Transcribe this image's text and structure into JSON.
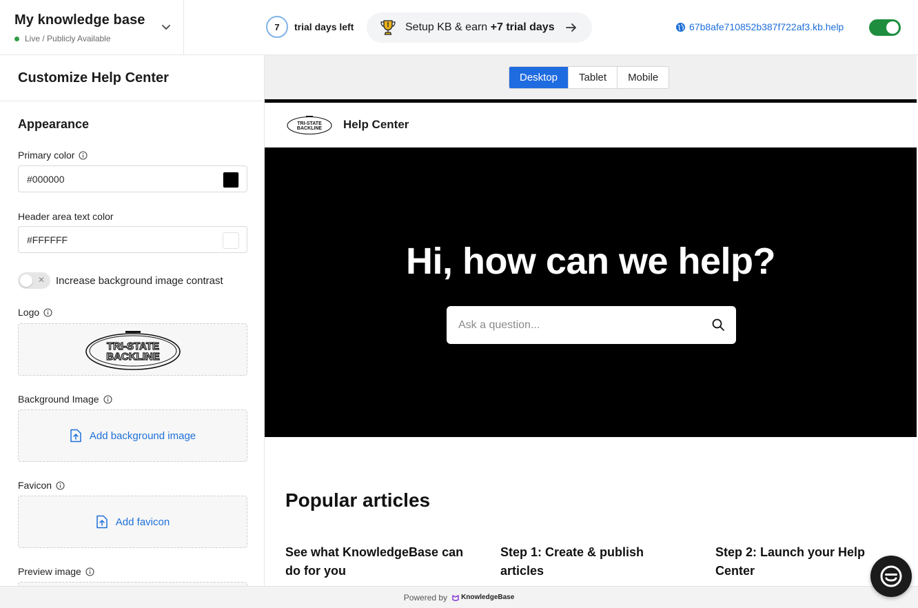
{
  "topbar": {
    "kb_name": "My knowledge base",
    "kb_status": "Live / Publicly Available",
    "trial_days": "7",
    "trial_text": "trial days left",
    "setup_text": "Setup KB & earn ",
    "setup_bonus": "+7 trial days",
    "kb_url": "67b8afe710852b387f722af3.kb.help"
  },
  "left": {
    "title": "Customize Help Center",
    "section": "Appearance",
    "primary_color_label": "Primary color",
    "primary_color_value": "#000000",
    "header_text_color_label": "Header area text color",
    "header_text_color_value": "#FFFFFF",
    "contrast_label": "Increase background image contrast",
    "logo_label": "Logo",
    "bg_image_label": "Background Image",
    "bg_image_add": "Add background image",
    "favicon_label": "Favicon",
    "favicon_add": "Add favicon",
    "preview_image_label": "Preview image"
  },
  "device_tabs": [
    "Desktop",
    "Tablet",
    "Mobile"
  ],
  "preview": {
    "header_title": "Help Center",
    "hero_title": "Hi, how can we help?",
    "search_placeholder": "Ask a question...",
    "popular_title": "Popular articles",
    "articles": [
      "See what KnowledgeBase can do for you",
      "Step 1: Create & publish articles",
      "Step 2: Launch your Help Center"
    ]
  },
  "footer": {
    "powered_by": "Powered by",
    "brand": "KnowledgeBase"
  },
  "logo_text": [
    "TRI-STATE",
    "BACKLINE"
  ],
  "colors": {
    "accent": "#1f6be0",
    "live_green": "#1e8e3e",
    "hero_bg": "#000000"
  },
  "icons": {
    "kb_switch": "chevron-down-icon",
    "setup": "trophy-icon",
    "setup_go": "arrow-right-icon",
    "url": "globe-icon",
    "info": "info-icon",
    "upload": "file-upload-icon",
    "search": "search-icon",
    "chat": "chat-icon"
  }
}
